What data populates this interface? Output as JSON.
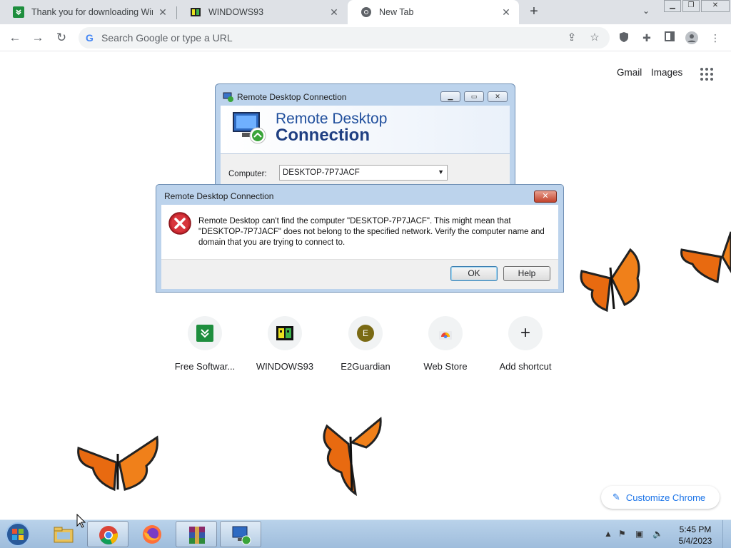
{
  "browser": {
    "tabs": [
      {
        "title": "Thank you for downloading WinR",
        "icon": "green-download-icon"
      },
      {
        "title": "WINDOWS93",
        "icon": "windows93-icon"
      },
      {
        "title": "New Tab",
        "icon": "chrome-icon",
        "active": true
      }
    ],
    "omnibox_placeholder": "Search Google or type a URL"
  },
  "ntp": {
    "gmail": "Gmail",
    "images": "Images",
    "shortcuts": [
      {
        "label": "Free Softwar...",
        "icon": "green-download-icon"
      },
      {
        "label": "WINDOWS93",
        "icon": "windows93-icon"
      },
      {
        "label": "E2Guardian",
        "icon": "letter-e-icon",
        "letter": "E"
      },
      {
        "label": "Web Store",
        "icon": "webstore-icon"
      },
      {
        "label": "Add shortcut",
        "icon": "plus-icon"
      }
    ],
    "customize": "Customize Chrome"
  },
  "rdp_window": {
    "title": "Remote Desktop Connection",
    "banner_line1": "Remote Desktop",
    "banner_line2": "Connection",
    "computer_label": "Computer:",
    "computer_value": "DESKTOP-7P7JACF"
  },
  "error_dialog": {
    "title": "Remote Desktop Connection",
    "message": "Remote Desktop can't find the computer \"DESKTOP-7P7JACF\". This might mean that \"DESKTOP-7P7JACF\" does not belong to the specified network.  Verify the computer name and domain that you are trying to connect to.",
    "ok": "OK",
    "help": "Help"
  },
  "taskbar": {
    "time": "5:45 PM",
    "date": "5/4/2023"
  }
}
